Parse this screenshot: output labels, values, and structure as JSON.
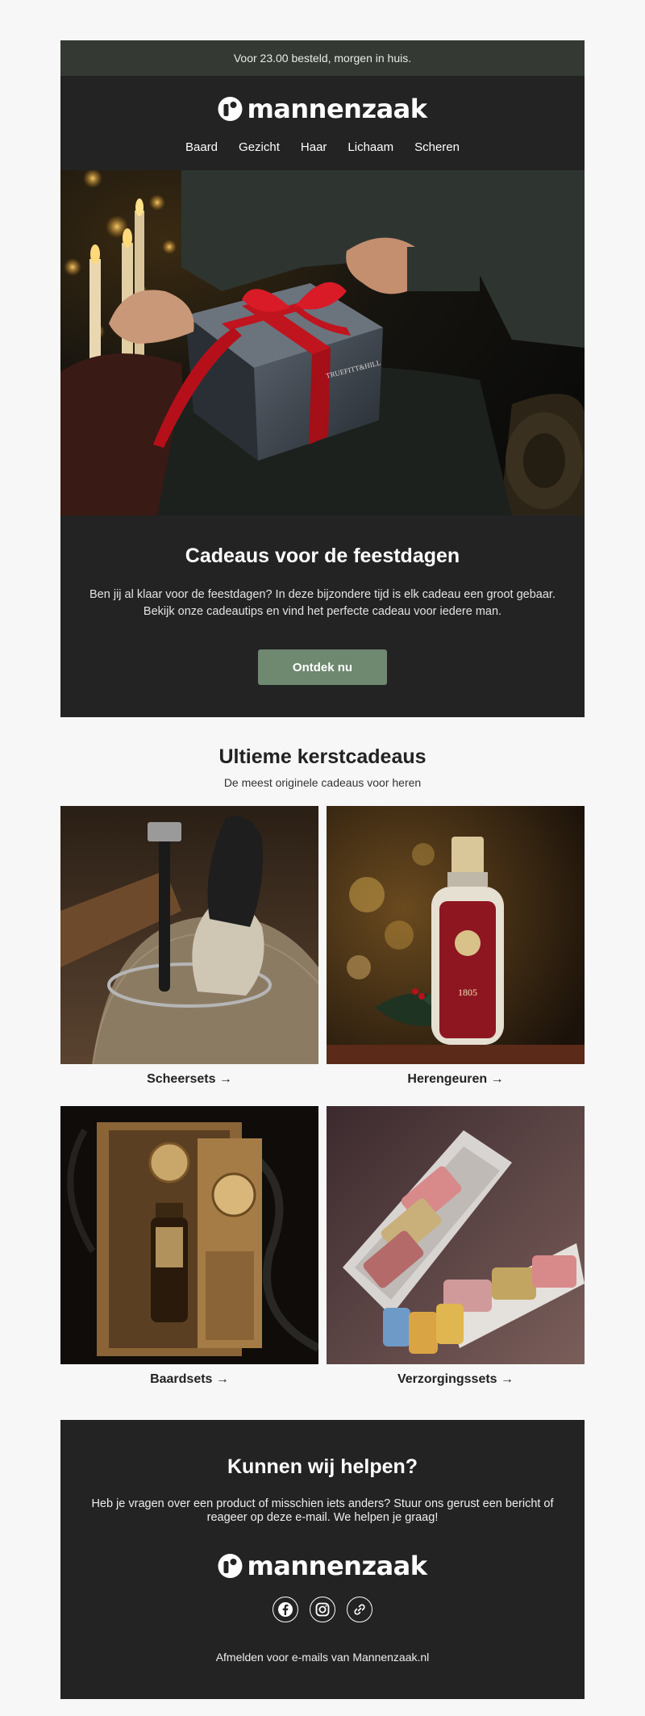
{
  "topbar": {
    "text": "Voor 23.00 besteld, morgen in huis."
  },
  "brand": {
    "name": "mannenzaak"
  },
  "nav": {
    "items": [
      "Baard",
      "Gezicht",
      "Haar",
      "Lichaam",
      "Scheren"
    ]
  },
  "hero": {
    "box_text": "TRUEFITT&HILL"
  },
  "intro": {
    "title": "Cadeaus voor de feestdagen",
    "text": "Ben jij al klaar voor de feestdagen? In deze bijzondere tijd is elk cadeau een groot gebaar. Bekijk onze cadeautips en vind het perfecte cadeau voor iedere man.",
    "button": "Ontdek nu",
    "button_color": "#6f8870"
  },
  "gifts": {
    "title": "Ultieme kerstcadeaus",
    "subtitle": "De meest originele cadeaus voor heren",
    "tiles": [
      {
        "label": "Scheersets →"
      },
      {
        "label": "Herengeuren →",
        "bottle_text": "1805"
      },
      {
        "label": "Baardsets →"
      },
      {
        "label": "Verzorgingssets →"
      }
    ]
  },
  "help": {
    "title": "Kunnen wij helpen?",
    "text": "Heb je vragen over een product of misschien iets anders? Stuur ons gerust een bericht of reageer op deze e-mail. We helpen je graag!",
    "social": [
      "facebook-icon",
      "instagram-icon",
      "link-icon"
    ],
    "unsubscribe": "Afmelden voor e-mails van Mannenzaak.nl"
  },
  "colors": {
    "dark": "#232323",
    "topbar": "#343a33",
    "accent": "#6f8870"
  }
}
